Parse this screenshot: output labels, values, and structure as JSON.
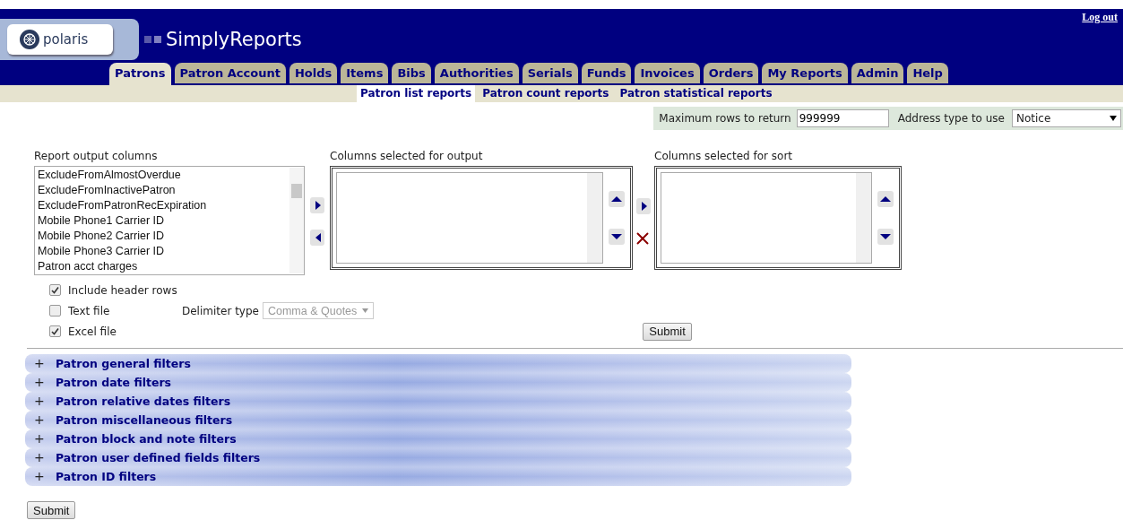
{
  "header": {
    "logo_text": "polaris",
    "app_title": "SimplyReports",
    "logout": "Log out"
  },
  "tabs": [
    {
      "label": "Patrons",
      "selected": true
    },
    {
      "label": "Patron Account",
      "selected": false
    },
    {
      "label": "Holds",
      "selected": false
    },
    {
      "label": "Items",
      "selected": false
    },
    {
      "label": "Bibs",
      "selected": false
    },
    {
      "label": "Authorities",
      "selected": false
    },
    {
      "label": "Serials",
      "selected": false
    },
    {
      "label": "Funds",
      "selected": false
    },
    {
      "label": "Invoices",
      "selected": false
    },
    {
      "label": "Orders",
      "selected": false
    },
    {
      "label": "My Reports",
      "selected": false
    },
    {
      "label": "Admin",
      "selected": false
    },
    {
      "label": "Help",
      "selected": false
    }
  ],
  "subtabs": [
    {
      "label": "Patron list reports",
      "selected": true
    },
    {
      "label": "Patron count reports",
      "selected": false
    },
    {
      "label": "Patron statistical reports",
      "selected": false
    }
  ],
  "options": {
    "max_rows_label": "Maximum rows to return",
    "max_rows_value": "999999",
    "address_label": "Address type to use",
    "address_value": "Notice"
  },
  "available_columns": {
    "label": "Report output columns",
    "items": [
      "ExcludeFromAlmostOverdue",
      "ExcludeFromInactivePatron",
      "ExcludeFromPatronRecExpiration",
      "Mobile Phone1 Carrier ID",
      "Mobile Phone2 Carrier ID",
      "Mobile Phone3 Carrier ID",
      "Patron acct charges"
    ]
  },
  "output_columns": {
    "label": "Columns selected for output"
  },
  "sort_columns": {
    "label": "Columns selected for sort"
  },
  "file_options": [
    {
      "label": "Include header rows",
      "checked": true
    },
    {
      "label": "Text file",
      "checked": false
    },
    {
      "label": "Excel file",
      "checked": true
    }
  ],
  "delimiter": {
    "label": "Delimiter type",
    "value": "Comma & Quotes",
    "disabled": true
  },
  "submit_top": "Submit",
  "filters": [
    {
      "toggle": "+",
      "label": "Patron general filters"
    },
    {
      "toggle": "+",
      "label": "Patron date filters"
    },
    {
      "toggle": "+",
      "label": "Patron relative dates filters"
    },
    {
      "toggle": "+",
      "label": "Patron miscellaneous filters"
    },
    {
      "toggle": "+",
      "label": "Patron block and note filters"
    },
    {
      "toggle": "+",
      "label": "Patron user defined fields filters"
    },
    {
      "toggle": "+",
      "label": "Patron ID filters"
    }
  ],
  "submit_bottom": "Submit"
}
